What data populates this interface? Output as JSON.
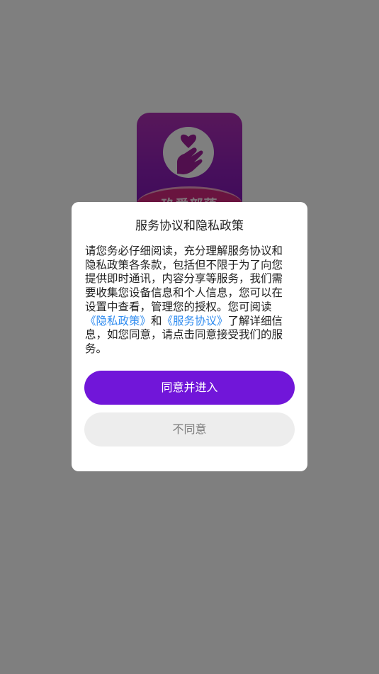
{
  "app": {
    "logo_text": "玖爱部落",
    "logo_icon": "heart-hand-icon"
  },
  "dialog": {
    "title": "服务协议和隐私政策",
    "body_intro": "请您务必仔细阅读，充分理解服务协议和隐私政策各条款，包括但不限于为了向您提供即时通讯，内容分享等服务，我们需要收集您设备信息和个人信息，您可以在设置中查看，管理您的授权。您可阅读",
    "privacy_link": "《隐私政策》",
    "conjunction": "和",
    "service_link": "《服务协议》",
    "body_outro": "了解详细信息，如您同意，请点击同意接受我们的服务。",
    "agree_label": "同意并进入",
    "disagree_label": "不同意"
  },
  "colors": {
    "accent": "#7116d9",
    "link": "#2f8cf0",
    "overlay": "rgba(0,0,0,0.5)",
    "secondary_button": "#ededed"
  }
}
